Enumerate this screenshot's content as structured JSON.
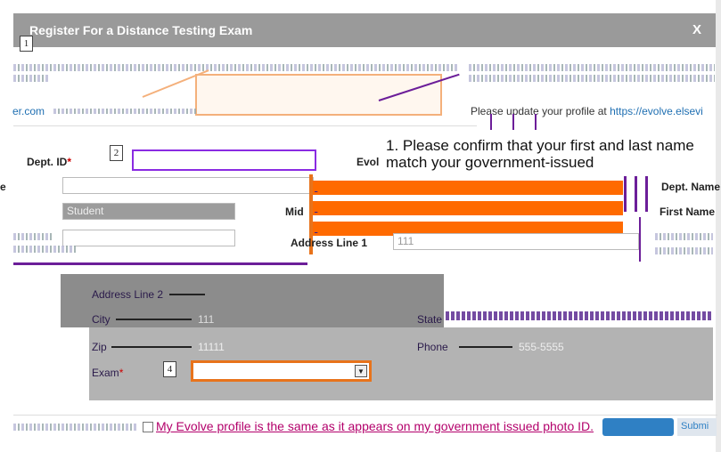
{
  "dialog": {
    "title": "Register For a Distance Testing Exam",
    "close_label": "X"
  },
  "callouts": [
    "1",
    "2",
    "4"
  ],
  "top": {
    "link_left": "er.com",
    "profile_prefix": "Please update your profile at ",
    "profile_link": "https://evolve.elsevi"
  },
  "form": {
    "dept_id_label": "Dept. ID",
    "evolve_label": "Evol",
    "e_label": "e",
    "student_value": "Student",
    "middle_label": "Mid",
    "dept_name_label": "Dept. Name",
    "first_name_label": "First Name",
    "address1_label": "Address Line 1",
    "address1_value": "111",
    "address2_label": "Address Line 2",
    "city_label": "City",
    "city_value": "111",
    "state_label": "State",
    "zip_label": "Zip",
    "zip_value": "11111",
    "phone_label": "Phone",
    "phone_value": "555-5555",
    "exam_label": "Exam",
    "required_mark": "*"
  },
  "instructions": {
    "text": "1. Please confirm that your first and last name match your government-issued"
  },
  "confirm": {
    "text": "My Evolve profile is the same as it appears on my government issued photo ID.",
    "submit_label": "Submi"
  }
}
